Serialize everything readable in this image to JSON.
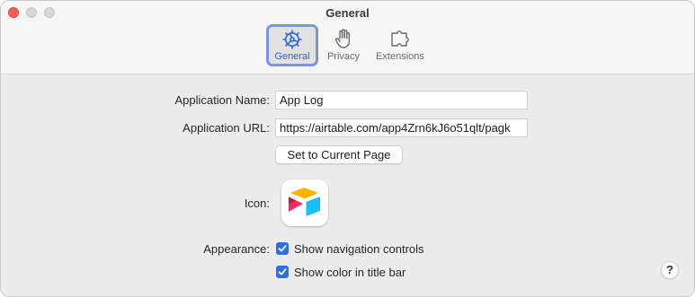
{
  "window": {
    "title": "General"
  },
  "tabs": [
    {
      "label": "General",
      "icon": "gear-icon",
      "selected": true
    },
    {
      "label": "Privacy",
      "icon": "hand-icon",
      "selected": false
    },
    {
      "label": "Extensions",
      "icon": "puzzle-icon",
      "selected": false
    }
  ],
  "form": {
    "app_name_label": "Application Name:",
    "app_name_value": "App Log",
    "app_url_label": "Application URL:",
    "app_url_value": "https://airtable.com/app4Zrn6kJ6o51qlt/pagk",
    "set_current_page_label": "Set to Current Page",
    "icon_label": "Icon:",
    "appearance_label": "Appearance:",
    "show_nav_controls_label": "Show navigation controls",
    "show_nav_controls_checked": true,
    "show_color_title_label": "Show color in title bar",
    "show_color_title_checked": true
  },
  "help": {
    "label": "?"
  },
  "colors": {
    "accent": "#2f6fe4",
    "selected_tab_border": "#7a95e6",
    "close_button": "#ff5f57"
  }
}
